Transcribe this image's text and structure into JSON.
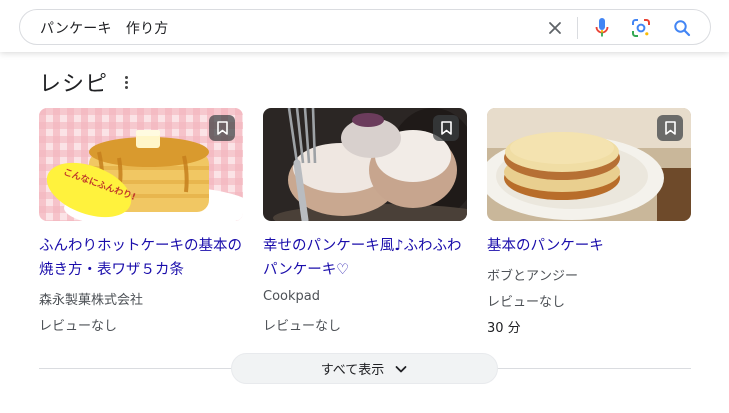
{
  "search": {
    "query": "パンケーキ　作り方"
  },
  "section": {
    "title": "レシピ"
  },
  "cards": [
    {
      "title": "ふんわりホットケーキの基本の焼き方・表ワザ５カ条",
      "source": "森永製菓株式会社",
      "rating": "レビューなし",
      "image_text": "こんなにふんわり!"
    },
    {
      "title": "幸せのパンケーキ風♪ふわふわパンケーキ♡",
      "source": "Cookpad",
      "rating": "レビューなし"
    },
    {
      "title": "基本のパンケーキ",
      "source": "ボブとアンジー",
      "rating": "レビューなし",
      "time": "30 分"
    }
  ],
  "footer": {
    "show_all_label": "すべて表示"
  },
  "colors": {
    "link": "#1a0dab",
    "google_blue": "#4285f4",
    "google_red": "#ea4335",
    "google_yellow": "#fbbc04",
    "google_green": "#34a853"
  },
  "icons": [
    "close-icon",
    "microphone-icon",
    "lens-icon",
    "search-icon",
    "more-vert-icon",
    "bookmark-icon",
    "chevron-down-icon"
  ]
}
